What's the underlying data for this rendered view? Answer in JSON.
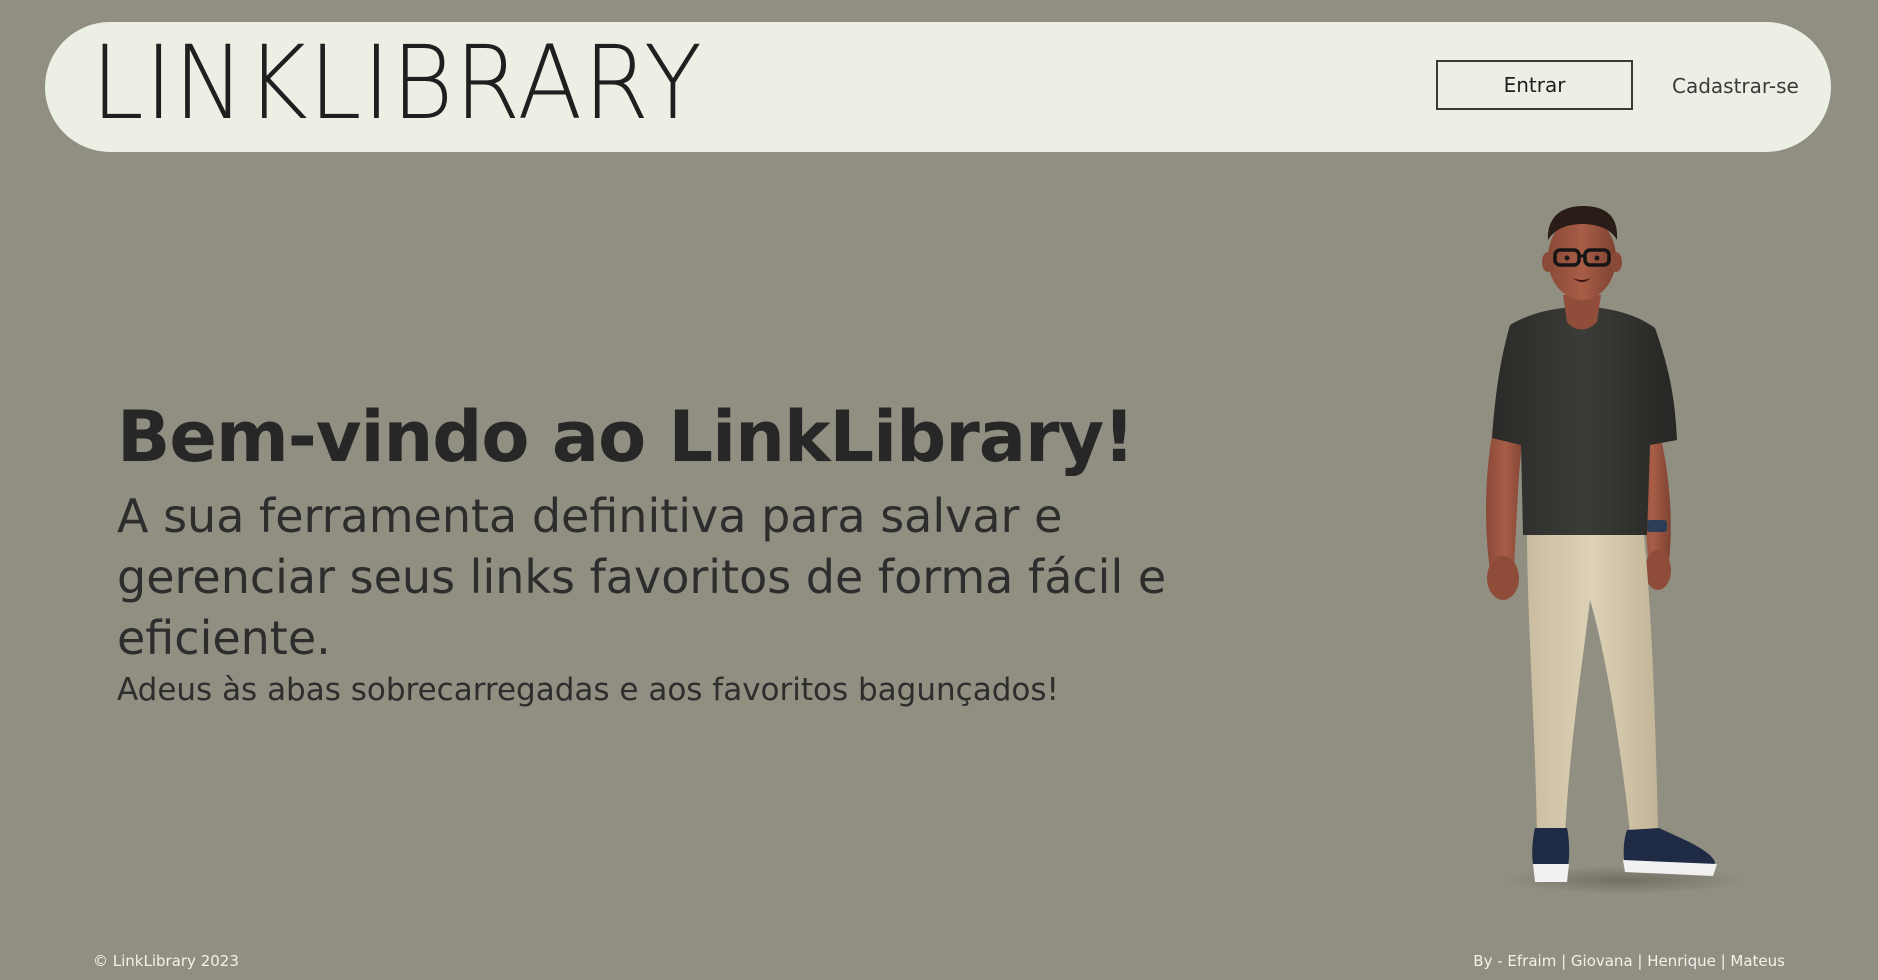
{
  "header": {
    "logo_text": "LINKLIBRARY",
    "login_label": "Entrar",
    "signup_label": "Cadastrar-se"
  },
  "hero": {
    "title": "Bem-vindo ao LinkLibrary!",
    "subtitle": "A sua ferramenta definitiva para salvar e gerenciar seus links favoritos de forma fácil e eficiente.",
    "tagline": "Adeus às abas sobrecarregadas e aos favoritos bagunçados!"
  },
  "illustration": {
    "icon": "person-standing-illustration"
  },
  "footer": {
    "copyright": "© LinkLibrary 2023",
    "credits": "By - Efraim | Giovana | Henrique | Mateus"
  },
  "colors": {
    "background": "#918f81",
    "header_bg": "#ebefe4",
    "text_dark": "#272727",
    "footer_text": "#f2f2ec"
  }
}
